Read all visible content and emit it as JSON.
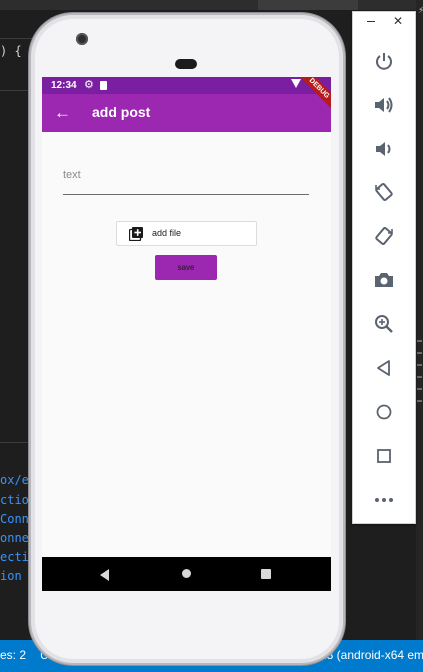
{
  "ide": {
    "code_top": ") {",
    "code_lines": [
      "ox/e",
      "ctio",
      "Conn",
      "onne",
      "ecti",
      "ion"
    ],
    "status_left": "es: 2",
    "status_mid": "U",
    "status_right": "28 (android-x64 em"
  },
  "device": {
    "status_time": "12:34",
    "appbar": {
      "title": "add post",
      "back_icon": "arrow-back-icon"
    },
    "debug_banner": "DEBUG",
    "text_field": {
      "placeholder": "text",
      "value": ""
    },
    "add_file_button": {
      "label": "add file",
      "icon": "library-add-icon"
    },
    "save_button": {
      "label": "save"
    },
    "colors": {
      "primary": "#9c27b0",
      "primary_dark": "#7b1fa2",
      "background": "#fafafa"
    }
  },
  "emulator_toolbar": {
    "window_controls": [
      "minimize",
      "close"
    ],
    "buttons": [
      "power-icon",
      "volume-up-icon",
      "volume-down-icon",
      "rotate-left-icon",
      "rotate-right-icon",
      "camera-icon",
      "zoom-icon",
      "back-icon",
      "home-icon",
      "overview-icon",
      "more-icon"
    ]
  }
}
